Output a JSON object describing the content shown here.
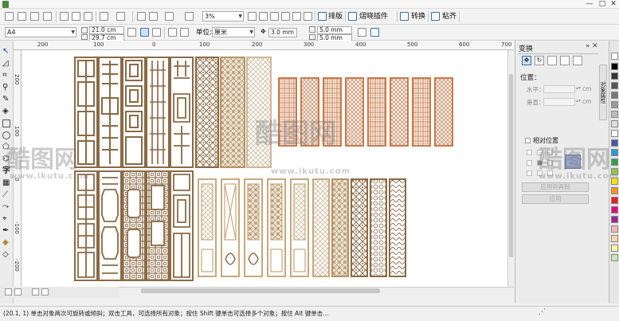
{
  "window": {
    "minimize": "—",
    "maximize": "□",
    "close": "✕"
  },
  "toolbar": {
    "zoom_value": "3%",
    "arrange_label": "排版",
    "plugin_label": "熠晓插件",
    "convert_label": "转换",
    "paste_label": "粘齐"
  },
  "property_bar": {
    "page_size": "A4",
    "width": "21.0 cm",
    "height": "29.7 cm",
    "unit_label": "单位:",
    "unit_value": "厘米",
    "nudge": "3.0 mm",
    "dup_x": "5.0 mm",
    "dup_y": "5.0 mm"
  },
  "ruler": {
    "top_ticks": [
      "200",
      "100",
      "0",
      "100",
      "200",
      "300",
      "400",
      "500",
      "600",
      "700"
    ],
    "left_ticks": [
      "-200",
      "-100",
      "0",
      "100",
      "200"
    ]
  },
  "docker": {
    "title": "变换",
    "position_label": "位置：",
    "h_label": "水平：",
    "v_label": "垂直：",
    "h_value": "",
    "v_value": "",
    "unit_cm": "cm",
    "relative_label": "相对位置",
    "apply_dup_label": "应用到再制",
    "apply_label": "应用",
    "side_tab": "对象属性"
  },
  "status": {
    "text": "(20.1, 1) 单击对象两次可旋转或倾斜；双击工具，可选择所有对象；按住 Shift 键单击可选择多个对象；按住 Alt 键单击..."
  },
  "watermarks": {
    "logo": "酷图网",
    "url": "www.ikutu.com"
  },
  "colors": {
    "panel_brown": "#8b6a45",
    "panel_tan": "#c8a87c",
    "panel_orange": "#c97a4a",
    "panel_light": "#e6d8c3"
  }
}
